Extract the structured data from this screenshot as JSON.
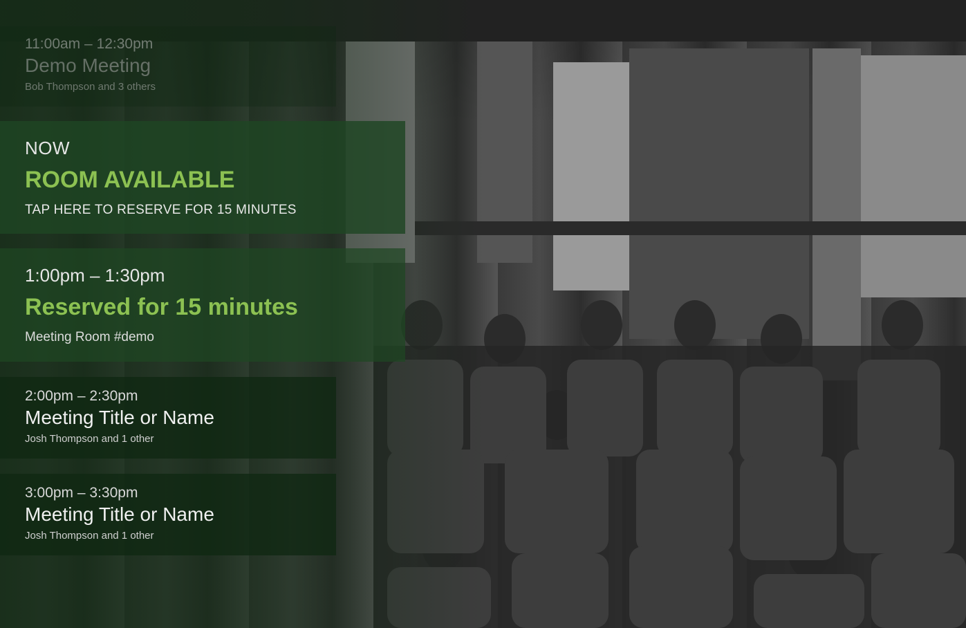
{
  "schedule": {
    "past": {
      "time": "11:00am – 12:30pm",
      "title": "Demo Meeting",
      "attendees": "Bob Thompson and 3 others"
    },
    "now": {
      "label": "NOW",
      "status": "ROOM AVAILABLE",
      "action": "TAP HERE TO RESERVE FOR 15 MINUTES"
    },
    "current": {
      "time": "1:00pm – 1:30pm",
      "title": "Reserved for 15 minutes",
      "room": "Meeting Room #demo"
    },
    "upcoming": [
      {
        "time": "2:00pm – 2:30pm",
        "title": "Meeting Title or Name",
        "attendees": "Josh Thompson and 1 other"
      },
      {
        "time": "3:00pm – 3:30pm",
        "title": "Meeting Title or Name",
        "attendees": "Josh Thompson and 1 other"
      }
    ]
  },
  "colors": {
    "accent": "#8cc152",
    "panel": "#1e4623"
  }
}
